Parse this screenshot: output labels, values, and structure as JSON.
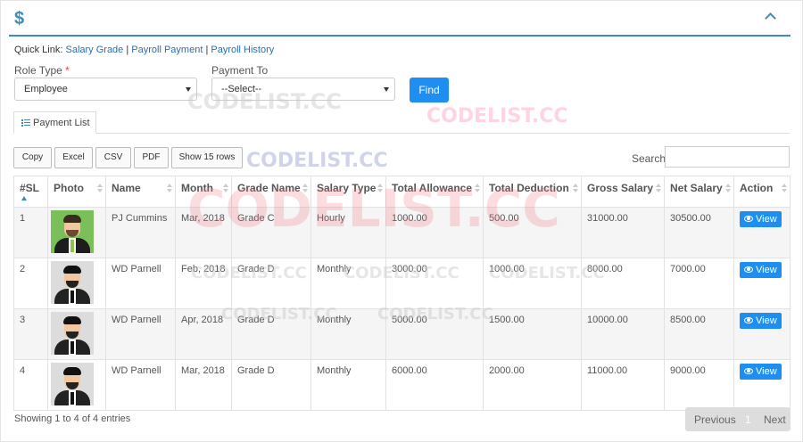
{
  "header": {
    "icon": "dollar-icon",
    "symbol": "$",
    "collapse_icon": "chevron-up-icon"
  },
  "quick_links": {
    "prefix": "Quick Link:",
    "links": [
      "Salary Grade",
      "Payroll Payment",
      "Payroll History"
    ],
    "sep": "|"
  },
  "form": {
    "role_type_label": "Role Type",
    "required_mark": "*",
    "role_type_value": "Employee",
    "payment_to_label": "Payment To",
    "payment_to_value": "--Select--",
    "find_label": "Find"
  },
  "tab": {
    "label": "Payment List",
    "icon": "list-icon"
  },
  "toolbar": {
    "buttons": [
      "Copy",
      "Excel",
      "CSV",
      "PDF",
      "Show 15 rows"
    ],
    "search_label": "Search:"
  },
  "table": {
    "columns": [
      "#SL",
      "Photo",
      "Name",
      "Month",
      "Grade Name",
      "Salary Type",
      "Total Allowance",
      "Total Deduction",
      "Gross Salary",
      "Net Salary",
      "Action"
    ],
    "rows": [
      {
        "sl": "1",
        "name": "PJ Cummins",
        "month": "Mar, 2018",
        "grade": "Grade C",
        "type": "Hourly",
        "allowance": "1000.00",
        "deduction": "500.00",
        "gross": "31000.00",
        "net": "30500.00",
        "action": "View"
      },
      {
        "sl": "2",
        "name": "WD Parnell",
        "month": "Feb, 2018",
        "grade": "Grade D",
        "type": "Monthly",
        "allowance": "3000.00",
        "deduction": "1000.00",
        "gross": "8000.00",
        "net": "7000.00",
        "action": "View"
      },
      {
        "sl": "3",
        "name": "WD Parnell",
        "month": "Apr, 2018",
        "grade": "Grade D",
        "type": "Monthly",
        "allowance": "5000.00",
        "deduction": "1500.00",
        "gross": "10000.00",
        "net": "8500.00",
        "action": "View"
      },
      {
        "sl": "4",
        "name": "WD Parnell",
        "month": "Mar, 2018",
        "grade": "Grade D",
        "type": "Monthly",
        "allowance": "6000.00",
        "deduction": "2000.00",
        "gross": "11000.00",
        "net": "9000.00",
        "action": "View"
      }
    ]
  },
  "footer": {
    "info": "Showing 1 to 4 of 4 entries",
    "prev": "Previous",
    "page": "1",
    "next": "Next"
  },
  "watermark": "CODELIST.CC"
}
